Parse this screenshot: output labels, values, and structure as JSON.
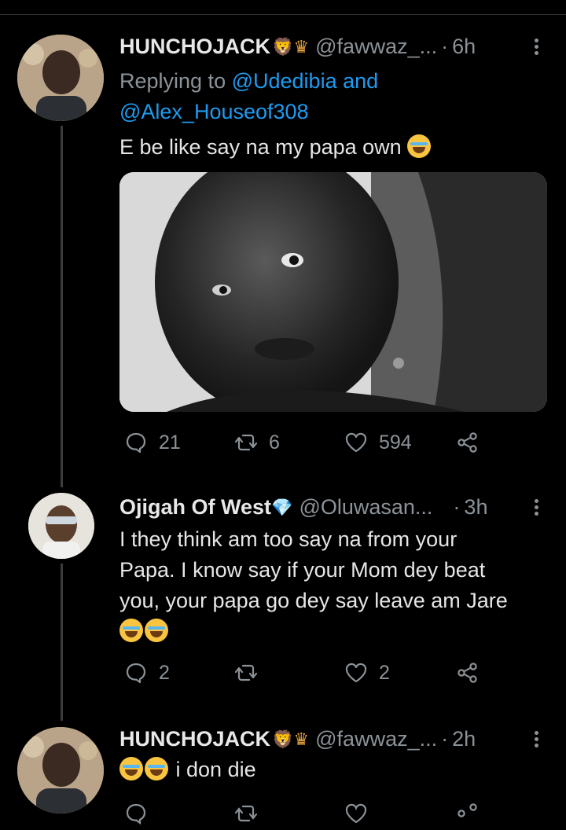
{
  "tweets": [
    {
      "name": "HUNCHOJACK",
      "name_emoji": "🦁♛",
      "handle": "@fawwaz_...",
      "time": "6h",
      "reply_prefix": "Replying to ",
      "reply_user1": "@Udedibia",
      "reply_and": " and",
      "reply_user2": "@Alex_Houseof308",
      "text": "E be like say na my papa own",
      "stats": {
        "replies": "21",
        "retweets": "6",
        "likes": "594"
      }
    },
    {
      "name": "Ojigah Of West",
      "name_emoji": "💎",
      "handle": "@Oluwasan...",
      "time": "3h",
      "text_line1": "I they think am too say na from your",
      "text_line2": "Papa. I know say if your Mom dey beat",
      "text_line3": "you, your papa go dey say leave am Jare",
      "stats": {
        "replies": "2",
        "retweets": "",
        "likes": "2"
      }
    },
    {
      "name": "HUNCHOJACK",
      "name_emoji": "🦁♛",
      "handle": "@fawwaz_...",
      "time": "2h",
      "text": "i don die"
    }
  ],
  "colors": {
    "background": "#000000",
    "link": "#1d9bf0",
    "muted": "#8b9298",
    "thread_line": "#3a3d40"
  }
}
